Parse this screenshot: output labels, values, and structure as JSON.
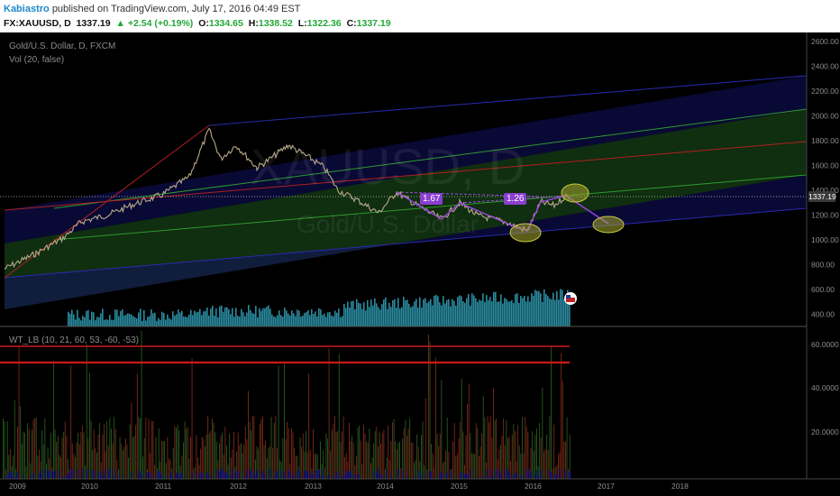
{
  "header": {
    "author": "Kabiastro",
    "published": "published on TradingView.com, July 17, 2016 04:49 EST",
    "symbol": "FX:XAUUSD, D",
    "price": "1337.19",
    "change_arrow": "▲",
    "change": "+2.54 (+0.19%)",
    "o_label": "O:",
    "o": "1334.65",
    "h_label": "H:",
    "h": "1338.52",
    "l_label": "L:",
    "l": "1322.36",
    "c_label": "C:",
    "c": "1337.19"
  },
  "legends": {
    "main": "Gold/U.S. Dollar, D, FXCM",
    "volume": "Vol (20, false)",
    "indicator": "WT_LB (10, 21, 60, 53, -60, -53)"
  },
  "watermark": {
    "symbol": "XAUUSD, D",
    "name": "Gold/U.S. Dollar"
  },
  "price_tag": "1337.19",
  "ratios": [
    "1.67",
    "1.26"
  ],
  "price_axis": [
    "2600.00",
    "2400.00",
    "2200.00",
    "2000.00",
    "1800.00",
    "1600.00",
    "1400.00",
    "1200.00",
    "1000.00",
    "800.00",
    "600.00",
    "400.00"
  ],
  "indicator_axis": [
    "60.0000",
    "40.0000",
    "20.0000"
  ],
  "time_axis": [
    "2009",
    "2010",
    "2011",
    "2012",
    "2013",
    "2014",
    "2015",
    "2016",
    "2017",
    "2018"
  ],
  "colors": {
    "background": "#000000",
    "channel_blue": "#1a1a8c",
    "channel_green": "#1f6b1f",
    "median": "#b02020",
    "price": "#b8a98a",
    "volume": "#2a8ba0",
    "pattern": "#9b45e0",
    "ellipse": "#a8a830",
    "threshold": "#d01818"
  }
}
